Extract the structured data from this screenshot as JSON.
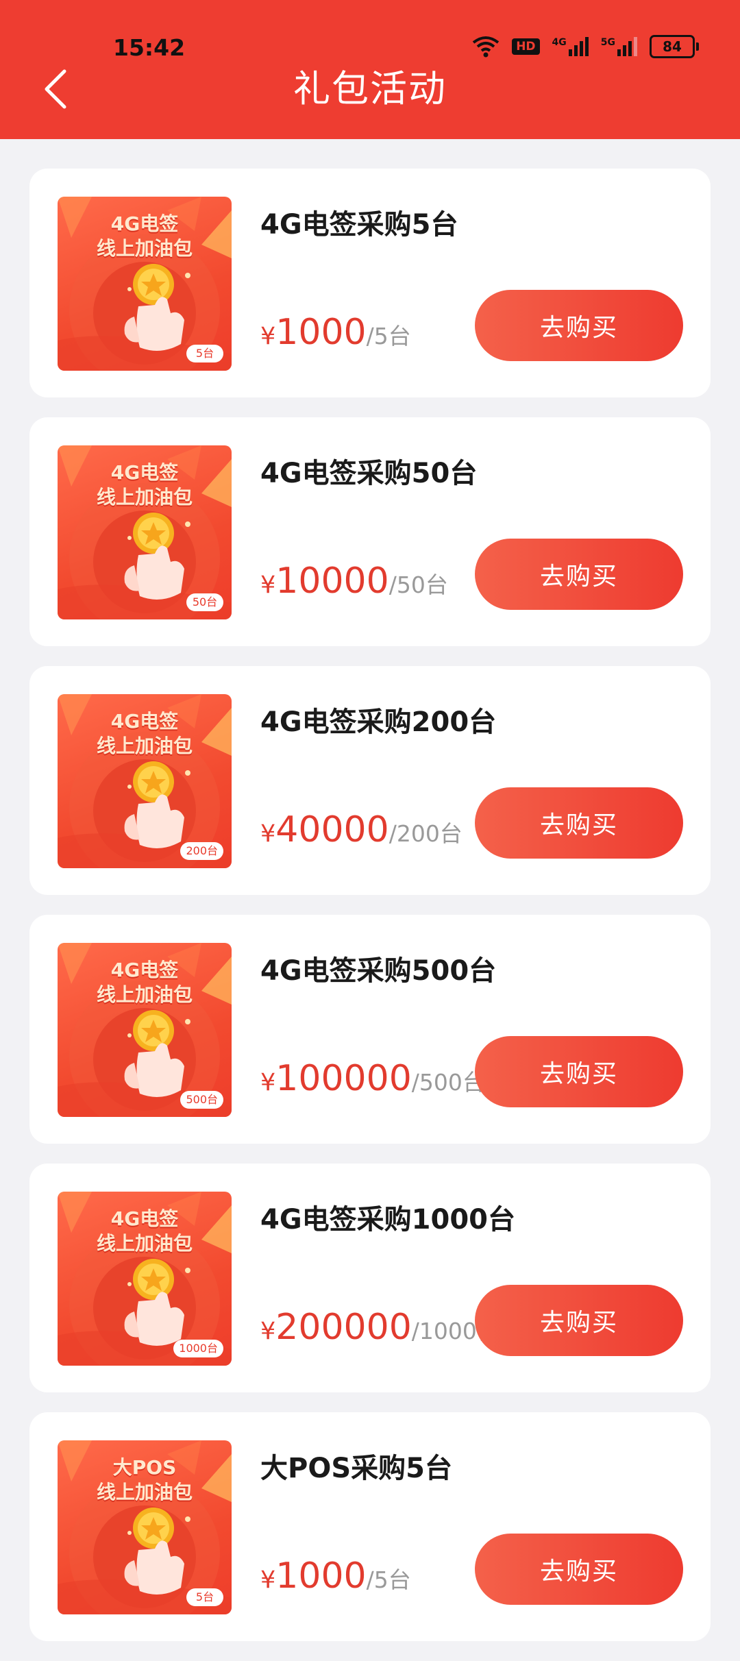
{
  "status_bar": {
    "time": "15:42",
    "battery": "84",
    "network_labels": [
      "HD",
      "4G",
      "5G"
    ],
    "icons": [
      "wifi-icon",
      "hd-icon",
      "signal-4g-icon",
      "signal-5g-icon",
      "battery-icon"
    ]
  },
  "header": {
    "title": "礼包活动",
    "back_icon": "chevron-left-icon",
    "background": "#ee3d31"
  },
  "theme": {
    "accent": "#ee3b30",
    "price_color": "#e23b2e",
    "page_bg": "#f2f2f5"
  },
  "items": [
    {
      "thumb_title_1": "4G电签",
      "thumb_title_2": "线上加油包",
      "thumb_tag": "5台",
      "title": "4G电签采购5台",
      "currency": "¥",
      "price": "1000",
      "unit": "/5台",
      "button": "去购买"
    },
    {
      "thumb_title_1": "4G电签",
      "thumb_title_2": "线上加油包",
      "thumb_tag": "50台",
      "title": "4G电签采购50台",
      "currency": "¥",
      "price": "10000",
      "unit": "/50台",
      "button": "去购买"
    },
    {
      "thumb_title_1": "4G电签",
      "thumb_title_2": "线上加油包",
      "thumb_tag": "200台",
      "title": "4G电签采购200台",
      "currency": "¥",
      "price": "40000",
      "unit": "/200台",
      "button": "去购买"
    },
    {
      "thumb_title_1": "4G电签",
      "thumb_title_2": "线上加油包",
      "thumb_tag": "500台",
      "title": "4G电签采购500台",
      "currency": "¥",
      "price": "100000",
      "unit": "/500台",
      "button": "去购买"
    },
    {
      "thumb_title_1": "4G电签",
      "thumb_title_2": "线上加油包",
      "thumb_tag": "1000台",
      "title": "4G电签采购1000台",
      "currency": "¥",
      "price": "200000",
      "unit": "/1000台",
      "button": "去购买"
    },
    {
      "thumb_title_1": "大POS",
      "thumb_title_2": "线上加油包",
      "thumb_tag": "5台",
      "title": "大POS采购5台",
      "currency": "¥",
      "price": "1000",
      "unit": "/5台",
      "button": "去购买"
    }
  ]
}
